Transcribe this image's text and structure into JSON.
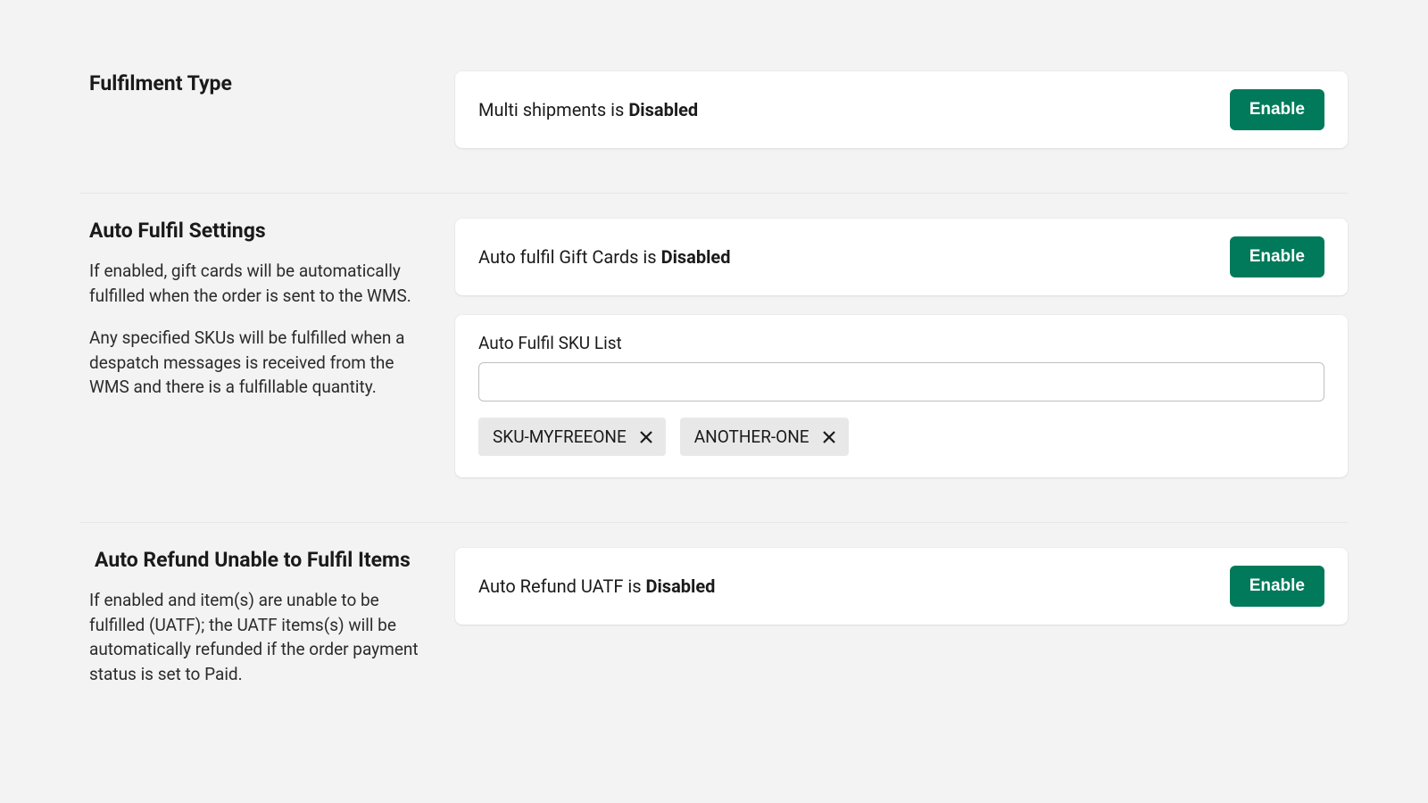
{
  "fulfilment_type": {
    "title": "Fulfilment Type",
    "status_prefix": "Multi shipments is ",
    "status_value": "Disabled",
    "button": "Enable"
  },
  "auto_fulfil": {
    "title": "Auto Fulfil Settings",
    "desc1": "If enabled, gift cards will be automatically fulfilled when the order is sent to the WMS.",
    "desc2": "Any specified SKUs will be fulfilled when a despatch messages is received from the WMS and there is a fulfillable quantity.",
    "status_prefix": "Auto fulfil Gift Cards is ",
    "status_value": "Disabled",
    "button": "Enable",
    "sku_label": "Auto Fulfil SKU List",
    "sku_input": "",
    "skus": [
      "SKU-MYFREEONE",
      "ANOTHER-ONE"
    ]
  },
  "auto_refund": {
    "title": "Auto Refund Unable to Fulfil Items",
    "desc": "If enabled and item(s) are unable to be fulfilled (UATF); the UATF items(s) will be automatically refunded if the order payment status is set to Paid.",
    "status_prefix": "Auto Refund UATF is ",
    "status_value": "Disabled",
    "button": "Enable"
  }
}
